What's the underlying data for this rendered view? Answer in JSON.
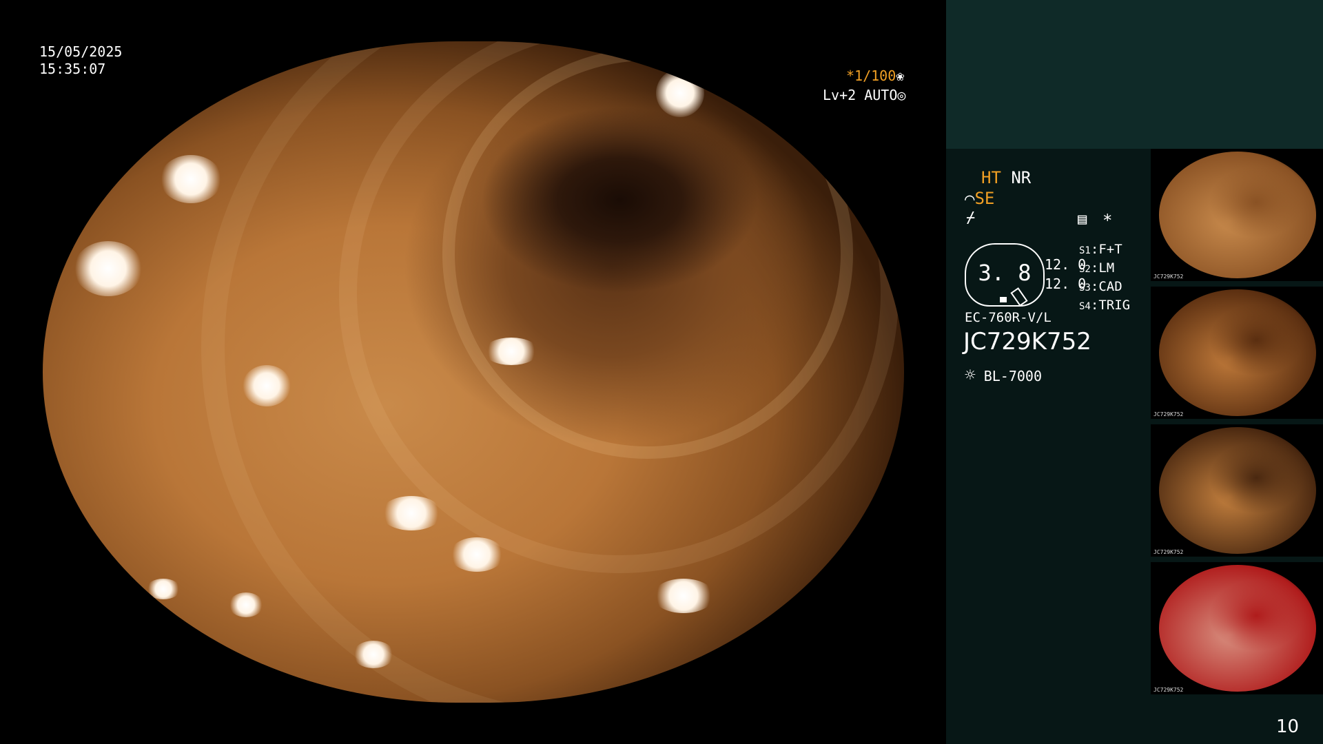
{
  "overlay": {
    "date": "15/05/2025",
    "time": "15:35:07",
    "shutter": "*1/100",
    "shutter_icon": "❀",
    "level": "Lv+2",
    "auto": "AUTO",
    "auto_icon": "◎"
  },
  "panel": {
    "mode_ht": "HT",
    "mode_nr": "NR",
    "se_icon": "⌒",
    "se_label": "SE",
    "freeze_icon": "⌿",
    "memory_icon": "▤",
    "star": "*",
    "gauge_value": "3. 8",
    "value_1": "12. 0",
    "value_2": "12. 0",
    "switches": [
      {
        "key": "S1",
        "value": "F+T"
      },
      {
        "key": "S2",
        "value": "LM"
      },
      {
        "key": "S3",
        "value": "CAD"
      },
      {
        "key": "S4",
        "value": "TRIG"
      }
    ],
    "scope_model": "EC-760R-V/L",
    "serial": "JC729K752",
    "light_icon": "☼",
    "light_source": "BL-7000",
    "page_number": "10"
  },
  "thumbnails": [
    {
      "caption": "JC729K752",
      "tone": "#c88a4c",
      "tone2": "#8a5224"
    },
    {
      "caption": "JC729K752",
      "tone": "#c07a3a",
      "tone2": "#5a2e10"
    },
    {
      "caption": "JC729K752",
      "tone": "#c4803e",
      "tone2": "#4a2810"
    },
    {
      "caption": "JC729K752",
      "tone": "#d88f7f",
      "tone2": "#b01c1c"
    }
  ],
  "colors": {
    "accent_orange": "#f2a024",
    "panel_top": "#0f2a28",
    "panel_body": "#071716"
  }
}
